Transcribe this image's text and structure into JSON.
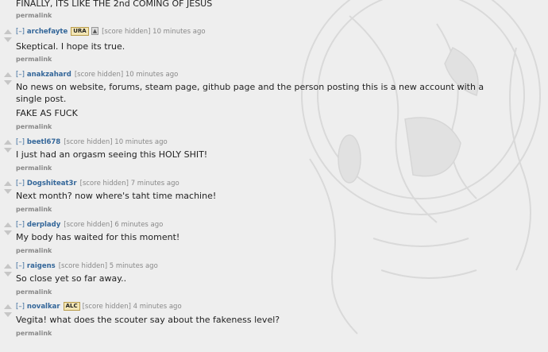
{
  "top_comment": {
    "text": "FINALLY, ITS LIKE THE 2nd COMING OF JESUS",
    "permalink": "permalink"
  },
  "comments": [
    {
      "expand": "[–]",
      "author": "archefayte",
      "flair1": "URA",
      "flair2": "",
      "score": "[score hidden]",
      "time": "10 minutes ago",
      "paragraphs": [
        "Skeptical. I hope its true."
      ],
      "permalink": "permalink"
    },
    {
      "expand": "[–]",
      "author": "anakzahard",
      "score": "[score hidden]",
      "time": "10 minutes ago",
      "paragraphs": [
        "No news on website, forums, steam page, github page and the person posting this is a new account with a single post.",
        "FAKE AS FUCK"
      ],
      "permalink": "permalink"
    },
    {
      "expand": "[–]",
      "author": "beetl678",
      "score": "[score hidden]",
      "time": "10 minutes ago",
      "paragraphs": [
        "I just had an orgasm seeing this HOLY SHIT!"
      ],
      "permalink": "permalink"
    },
    {
      "expand": "[–]",
      "author": "Dogshiteat3r",
      "score": "[score hidden]",
      "time": "7 minutes ago",
      "paragraphs": [
        "Next month? now where's taht time machine!"
      ],
      "permalink": "permalink"
    },
    {
      "expand": "[–]",
      "author": "derplady",
      "score": "[score hidden]",
      "time": "6 minutes ago",
      "paragraphs": [
        "My body has waited for this moment!"
      ],
      "permalink": "permalink"
    },
    {
      "expand": "[–]",
      "author": "raigens",
      "score": "[score hidden]",
      "time": "5 minutes ago",
      "paragraphs": [
        "So close yet so far away.."
      ],
      "permalink": "permalink"
    },
    {
      "expand": "[–]",
      "author": "novalkar",
      "flair1": "ALC",
      "score": "[score hidden]",
      "time": "4 minutes ago",
      "paragraphs": [
        "Vegita! what does the scouter say about the fakeness level?"
      ],
      "permalink": "permalink"
    }
  ]
}
